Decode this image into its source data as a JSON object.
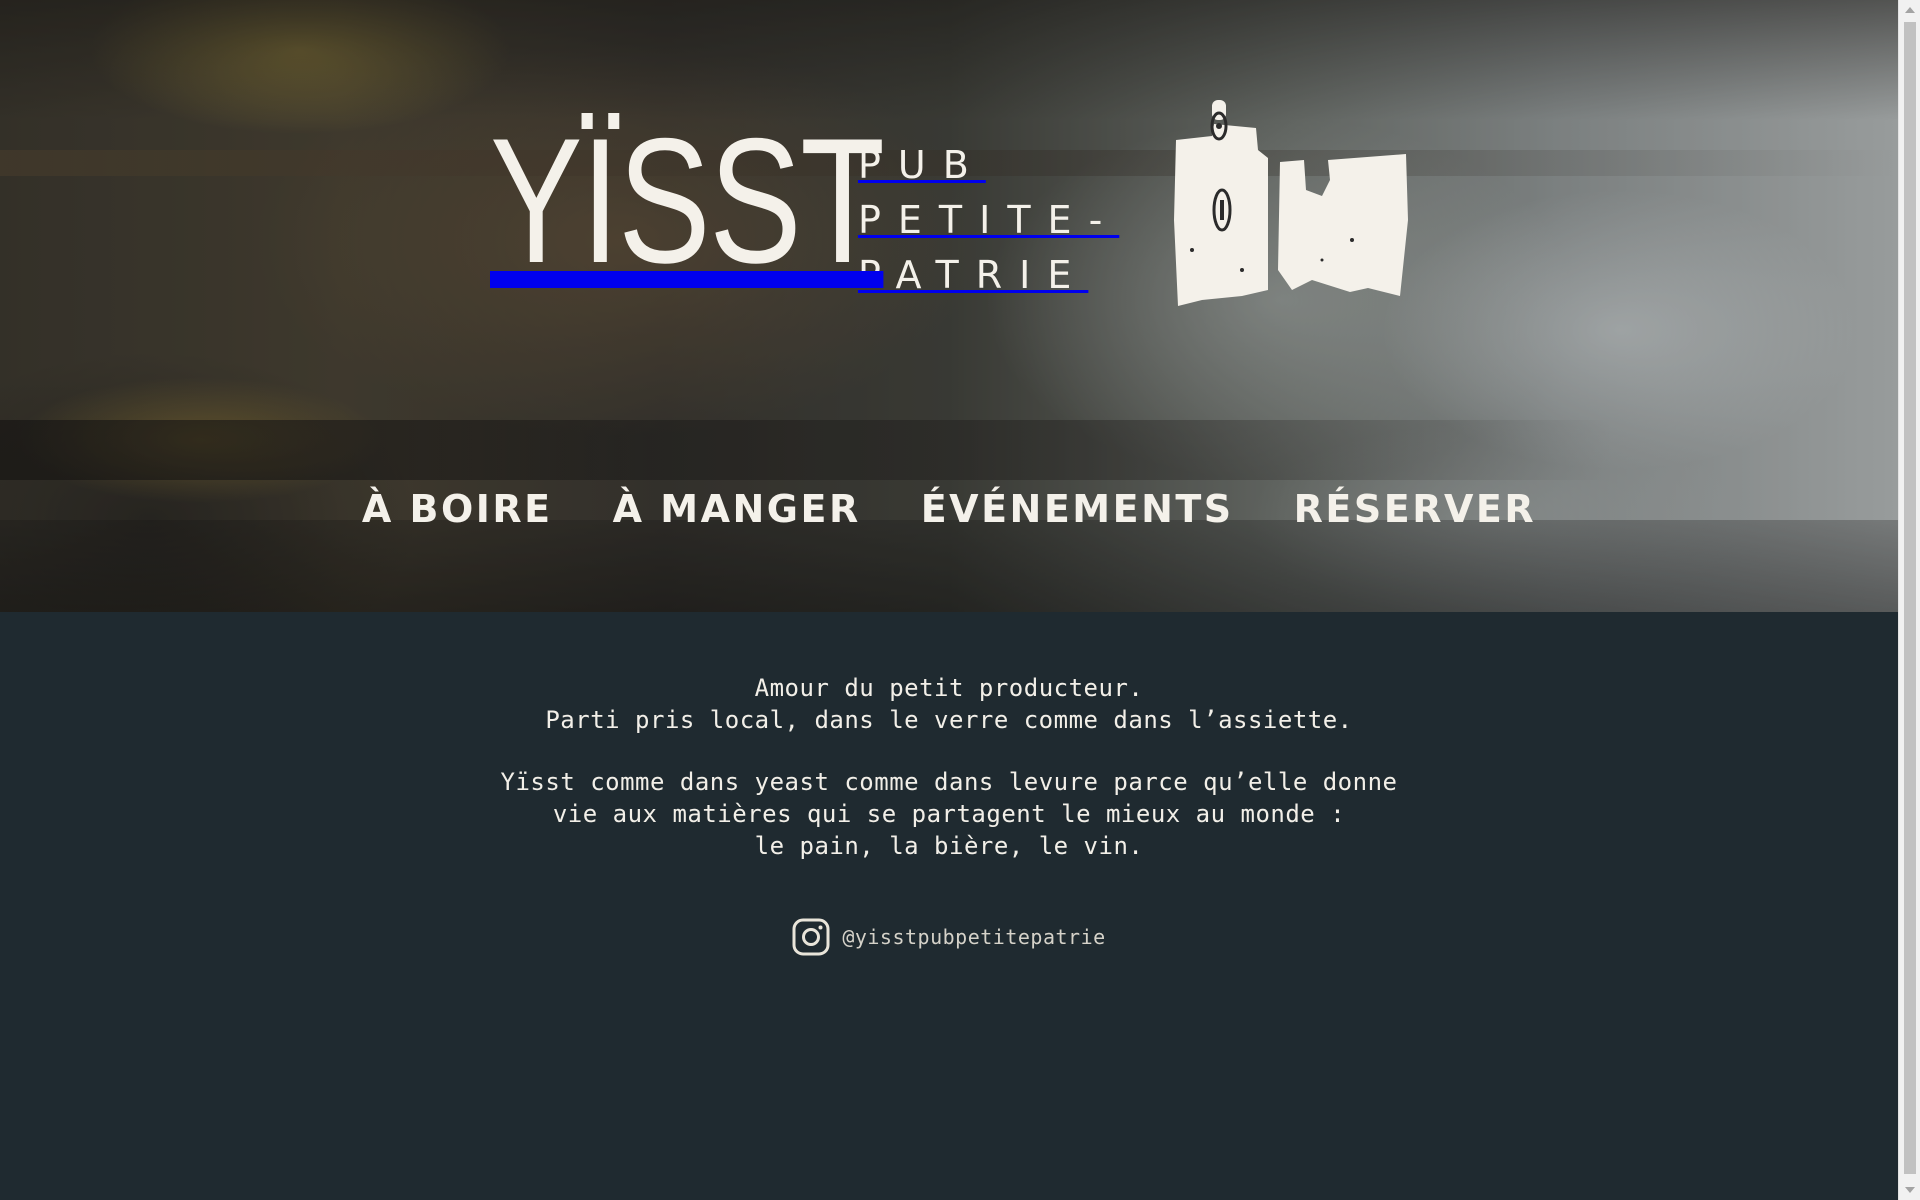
{
  "brand": {
    "wordmark": "YÏSST",
    "subtitle_lines": [
      "PUB",
      "PETITE-",
      "PATRIE"
    ],
    "emblem_icon": "boot-icon"
  },
  "nav": {
    "items": [
      {
        "label": "À BOIRE"
      },
      {
        "label": "À MANGER"
      },
      {
        "label": "ÉVÉNEMENTS"
      },
      {
        "label": "RÉSERVER"
      }
    ]
  },
  "about": {
    "paragraph1": [
      "Amour du petit producteur.",
      "Parti pris local, dans le verre comme dans l’assiette."
    ],
    "paragraph2": [
      "Yïsst comme dans yeast comme dans levure parce qu’elle donne",
      "vie aux matières qui se partagent le mieux au monde :",
      "le pain, la bière, le vin."
    ]
  },
  "social": {
    "icon": "instagram-icon",
    "handle": "@yisstpubpetitepatrie"
  },
  "colors": {
    "content_background": "#1f2a30",
    "text": "#f2efe8",
    "handle": "#d5d2c9"
  }
}
